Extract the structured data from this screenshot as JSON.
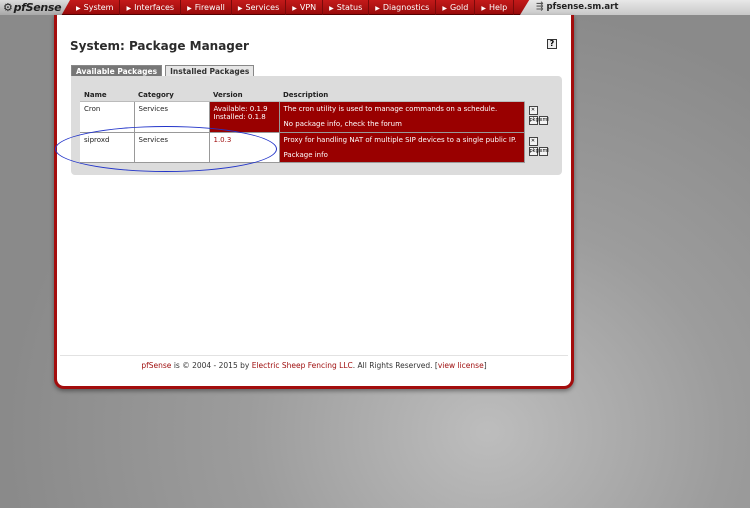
{
  "topbar": {
    "logo": "pfSense",
    "nav": [
      "System",
      "Interfaces",
      "Firewall",
      "Services",
      "VPN",
      "Status",
      "Diagnostics",
      "Gold",
      "Help"
    ],
    "hostname": "pfsense.sm.art"
  },
  "page": {
    "title": "System: Package Manager",
    "help": "?"
  },
  "tabs": [
    {
      "label": "Available Packages",
      "active": true
    },
    {
      "label": "Installed Packages",
      "active": false
    }
  ],
  "table": {
    "headers": [
      "Name",
      "Category",
      "Version",
      "Description"
    ],
    "rows": [
      {
        "name": "Cron",
        "category": "Services",
        "version_line1": "Available: 0.1.9",
        "version_line2": "Installed: 0.1.8",
        "description": "The cron utility is used to manage commands on a schedule.",
        "info": "No package info, check the forum"
      },
      {
        "name": "siproxd",
        "category": "Services",
        "version_line1": "1.0.3",
        "version_line2": "",
        "description": "Proxy for handling NAT of multiple SIP devices to a single public IP.",
        "info": "Package info"
      }
    ]
  },
  "footer": {
    "brand": "pfSense",
    "text_mid": " is © 2004 - 2015 by ",
    "company": "Electric Sheep Fencing LLC",
    "text_end": ". All Rights Reserved. [",
    "license": "view license",
    "close": "]"
  }
}
